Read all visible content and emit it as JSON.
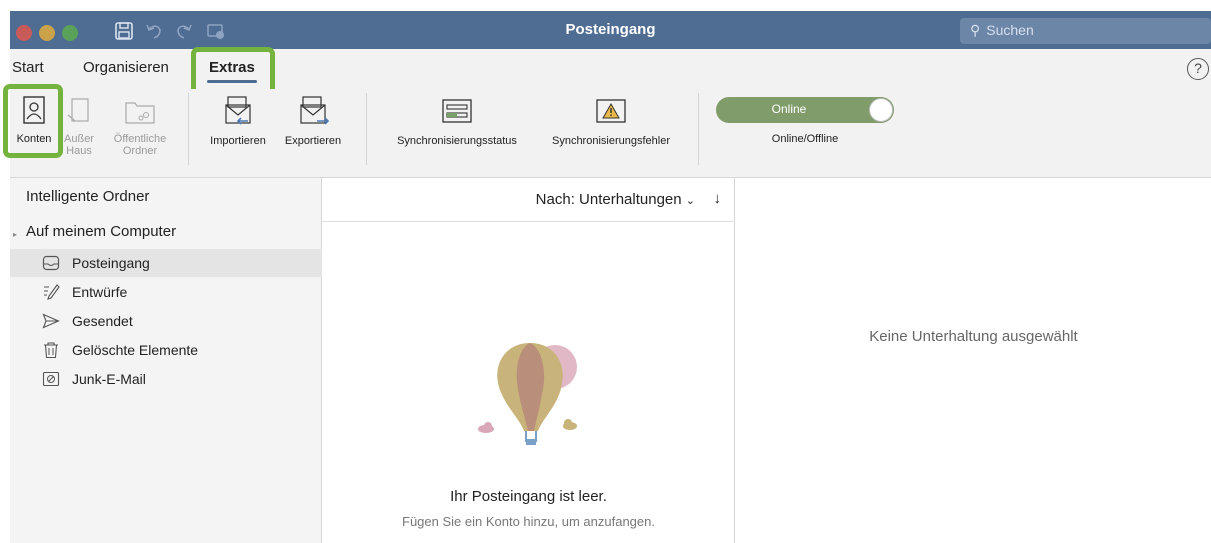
{
  "window": {
    "title": "Posteingang"
  },
  "search": {
    "placeholder": "Suchen"
  },
  "tabs": [
    {
      "label": "Start"
    },
    {
      "label": "Organisieren"
    },
    {
      "label": "Extras",
      "active": true
    }
  ],
  "ribbon": {
    "konten": "Konten",
    "ausser_haus": "Außer Haus",
    "oeffentliche_ordner": "Öffentliche Ordner",
    "importieren": "Importieren",
    "exportieren": "Exportieren",
    "sync_status": "Synchronisierungsstatus",
    "sync_fehler": "Synchronisierungsfehler",
    "toggle_state": "Online",
    "toggle_caption": "Online/Offline"
  },
  "sidebar": {
    "group1": "Intelligente Ordner",
    "group2": "Auf meinem Computer",
    "items": [
      {
        "label": "Posteingang",
        "icon": "inbox-icon",
        "selected": true
      },
      {
        "label": "Entwürfe",
        "icon": "drafts-icon"
      },
      {
        "label": "Gesendet",
        "icon": "sent-icon"
      },
      {
        "label": "Gelöschte Elemente",
        "icon": "trash-icon"
      },
      {
        "label": "Junk-E-Mail",
        "icon": "junk-icon"
      }
    ]
  },
  "message_list": {
    "sort_label": "Nach: Unterhaltungen",
    "empty_title": "Ihr Posteingang ist leer.",
    "empty_subtitle": "Fügen Sie ein Konto hinzu, um anzufangen."
  },
  "reading_pane": {
    "empty_text": "Keine Unterhaltung ausgewählt"
  },
  "colors": {
    "titlebar": "#4f6c93",
    "highlight_frame": "#75b33f",
    "toggle_on": "#7f9c6a"
  }
}
